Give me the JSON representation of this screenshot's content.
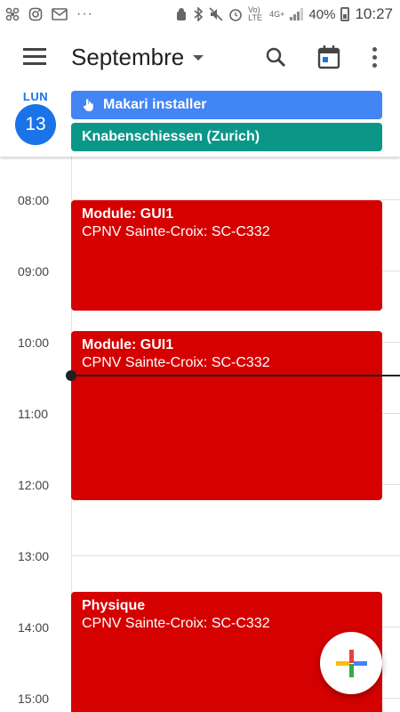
{
  "status_bar": {
    "left_icons": [
      "bluetooth-pinwheel-icon",
      "instagram-icon",
      "mail-icon"
    ],
    "overflow_dots": "···",
    "right_icons": [
      "android-icon",
      "bluetooth-icon",
      "mute-icon",
      "alarm-icon"
    ],
    "volte_label": "Vo) LTE",
    "network_label": "4G+",
    "battery_percent": "40%",
    "time": "10:27"
  },
  "app_bar": {
    "month": "Septembre",
    "icons": [
      "menu-icon",
      "caret-down-icon",
      "search-icon",
      "today-icon",
      "more-vert-icon"
    ]
  },
  "day": {
    "weekday": "LUN",
    "date": "13"
  },
  "all_day_events": [
    {
      "title": "Makari installer",
      "color": "#4285f4",
      "icon": "hand-pointer-icon"
    },
    {
      "title": "Knabenschiessen (Zurich)",
      "color": "#0b9688"
    }
  ],
  "hours": [
    "08:00",
    "09:00",
    "10:00",
    "11:00",
    "12:00",
    "13:00",
    "14:00",
    "15:00"
  ],
  "events": [
    {
      "title": "Module: GUI1",
      "location": "CPNV Sainte-Croix: SC-C332",
      "color": "#d50000"
    },
    {
      "title": "Module: GUI1",
      "location": "CPNV Sainte-Croix: SC-C332",
      "color": "#d50000"
    },
    {
      "title": "Physique",
      "location": "CPNV Sainte-Croix: SC-C332",
      "color": "#d50000"
    }
  ],
  "fab": {
    "icon": "add-icon",
    "colors": [
      "#ea4335",
      "#4285f4",
      "#34a853",
      "#fbbc04"
    ]
  }
}
